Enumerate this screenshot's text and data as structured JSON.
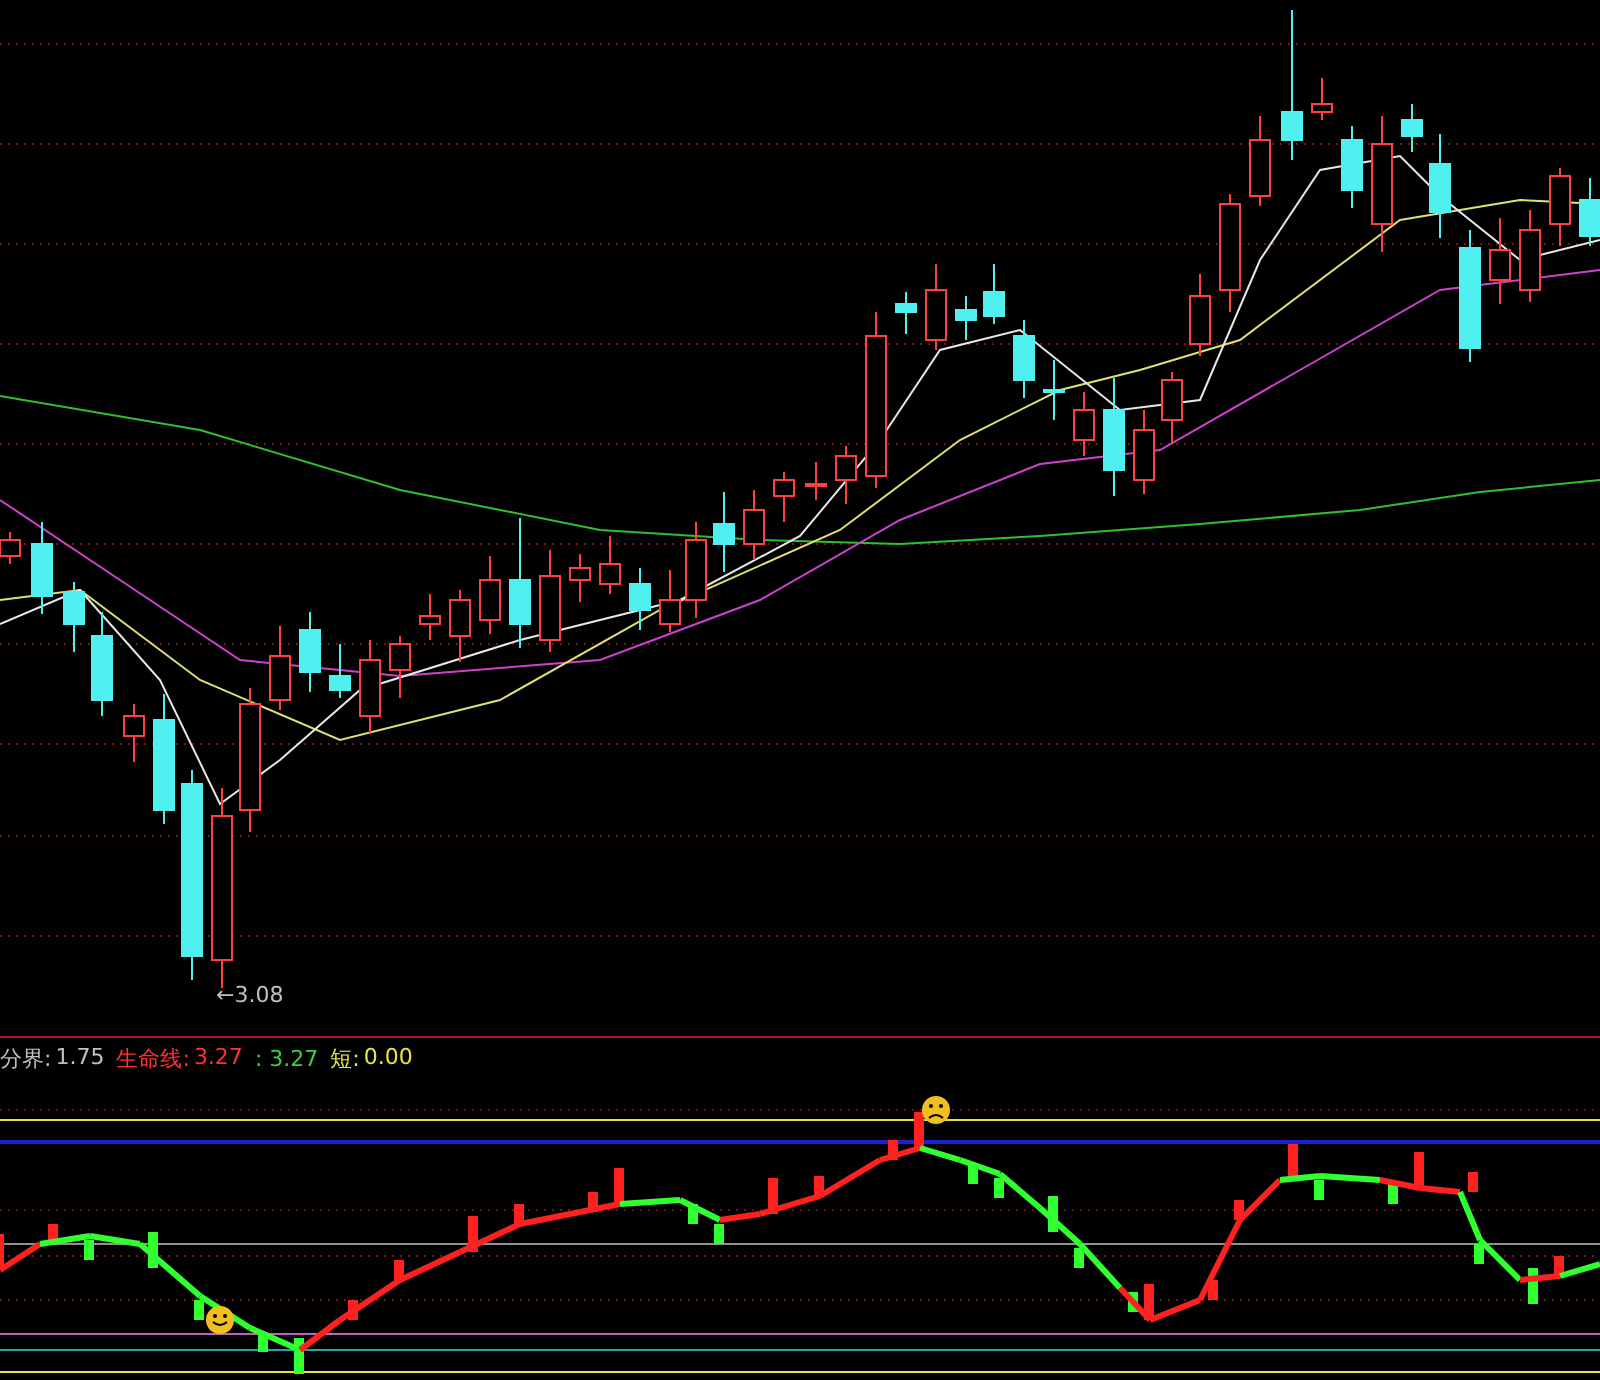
{
  "price_panel": {
    "low_label": "←3.08"
  },
  "indicator_legend": [
    {
      "label": "分界:",
      "value": "1.75",
      "color": "#c0c0c0"
    },
    {
      "label": "生命线:",
      "value": "3.27",
      "color": "#ff3232"
    },
    {
      "value": ": 3.27",
      "color": "#3cd23c"
    },
    {
      "label": "短:",
      "value": "0.00",
      "color": "#e6e64c"
    }
  ]
}
